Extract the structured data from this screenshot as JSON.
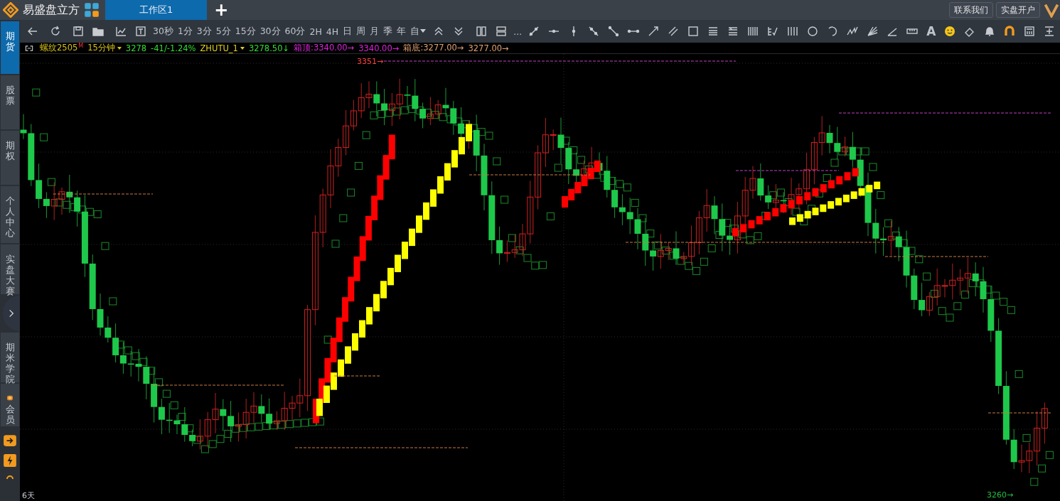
{
  "app": {
    "name": "易盛盘立方"
  },
  "tabs": [
    {
      "label": "工作区1",
      "selected": true
    }
  ],
  "add_tab": "+",
  "header_buttons": [
    "联系我们",
    "实盘开户"
  ],
  "toolbar": {
    "periods": [
      "30秒",
      "1分",
      "3分",
      "5分",
      "15分",
      "30分",
      "60分",
      "2H",
      "4H",
      "日",
      "周",
      "月",
      "季",
      "年"
    ],
    "custom_period": "自",
    "more": "...",
    "text_tool": "A"
  },
  "sidebar": {
    "items": [
      {
        "label": "期货",
        "selected": true
      },
      {
        "label": "股票",
        "selected": false
      },
      {
        "label": "期权",
        "selected": false
      },
      {
        "label": "个人中心",
        "selected": false
      },
      {
        "label": "实盘大赛",
        "selected": false
      },
      {
        "label": "期米学院",
        "selected": false
      },
      {
        "label": "会员",
        "selected": false
      }
    ]
  },
  "quote_bar": {
    "symbol": "螺纹2505",
    "symbol_badge": "M",
    "period": "15分钟",
    "price": "3278",
    "change": "-41/-1.24%",
    "indicator": "ZHUTU_1",
    "indicator_value": "3278.50↓",
    "box_top_label": "箱顶:3340.00→",
    "box_top_value": "3340.00→",
    "box_bottom_label": "箱底:3277.00→",
    "box_bottom_value": "3277.00→"
  },
  "chart": {
    "high_label": "3351→",
    "low_label": "3260→",
    "range_label": "6天"
  }
}
